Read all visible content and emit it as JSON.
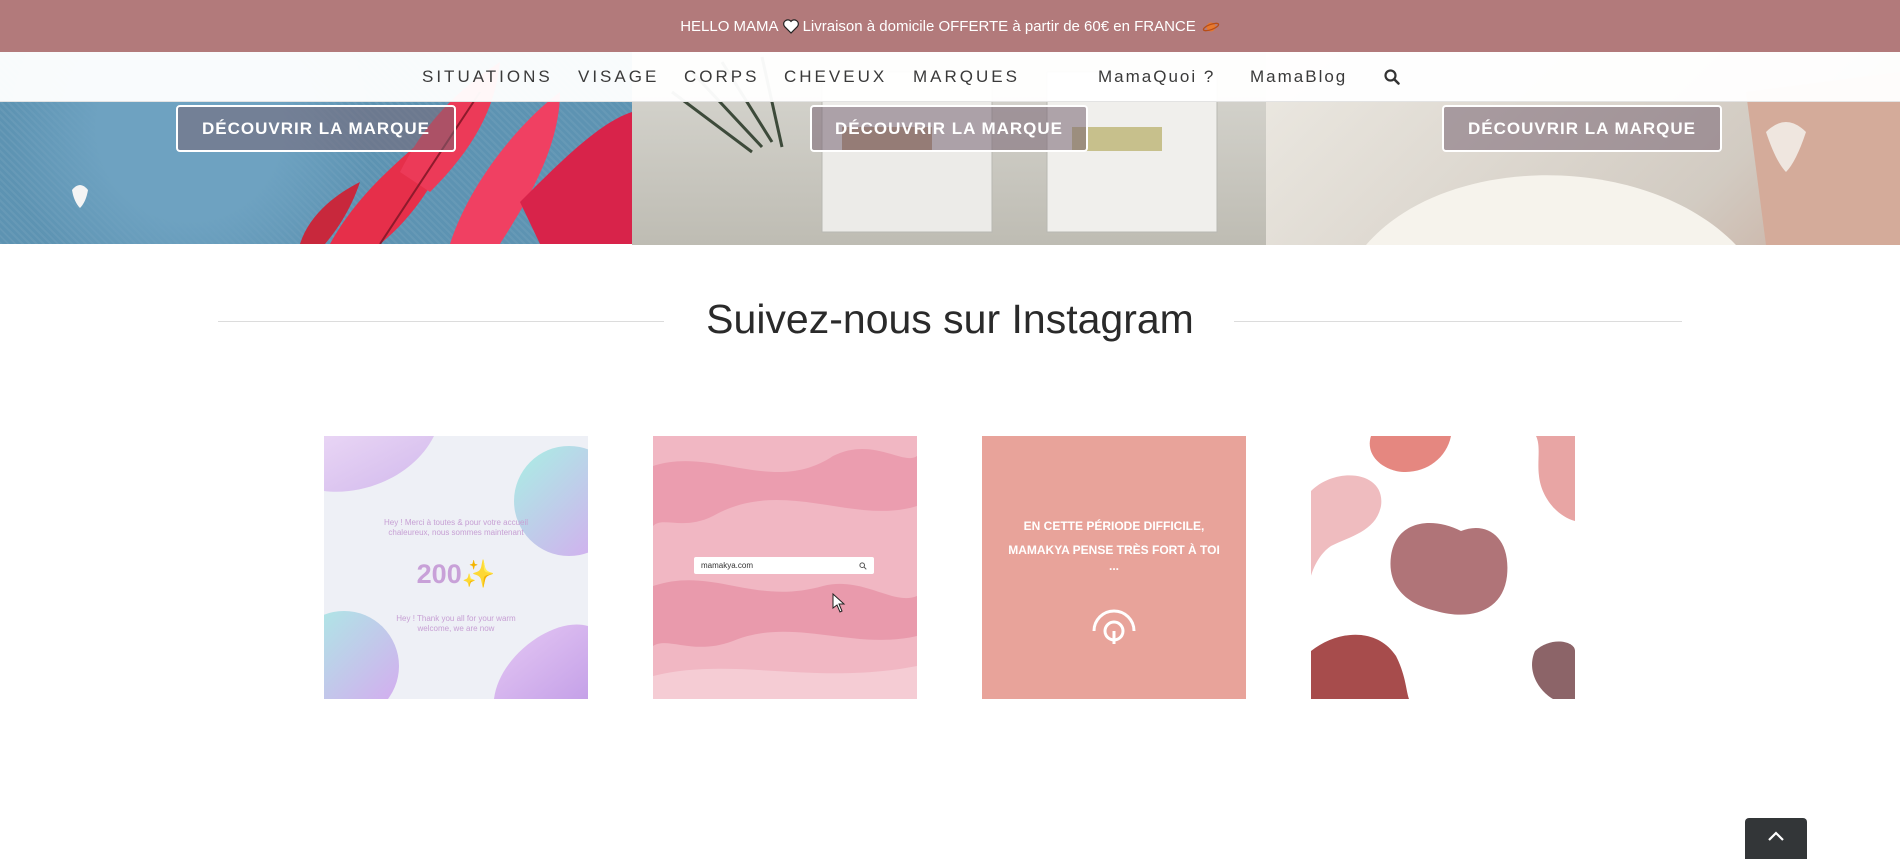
{
  "promo": {
    "greeting": "HELLO MAMA",
    "message": "Livraison à domicile OFFERTE à partir de 60€ en FRANCE"
  },
  "nav": {
    "items": [
      "SITUATIONS",
      "VISAGE",
      "CORPS",
      "CHEVEUX",
      "MARQUES"
    ],
    "secondary": [
      "MamaQuoi ?",
      "MamaBlog"
    ],
    "search_icon": "search-icon"
  },
  "brands": [
    {
      "cta": "DÉCOUVRIR LA MARQUE"
    },
    {
      "cta": "DÉCOUVRIR LA MARQUE"
    },
    {
      "cta": "DÉCOUVRIR LA MARQUE"
    }
  ],
  "instagram": {
    "title": "Suivez-nous sur Instagram",
    "posts": [
      {
        "line1": "Hey ! Merci à toutes & pour votre accueil",
        "line2": "chaleureux, nous sommes maintenant",
        "number": "200✨",
        "line3": "Hey ! Thank you all for your warm",
        "line4": "welcome, we are now"
      },
      {
        "search_text": "mamakya.com"
      },
      {
        "line1": "EN CETTE PÉRIODE DIFFICILE,",
        "line2": "MAMAKYA PENSE TRÈS FORT À TOI",
        "line3": "..."
      },
      {}
    ]
  },
  "scroll_top_icon": "chevron-up-icon"
}
